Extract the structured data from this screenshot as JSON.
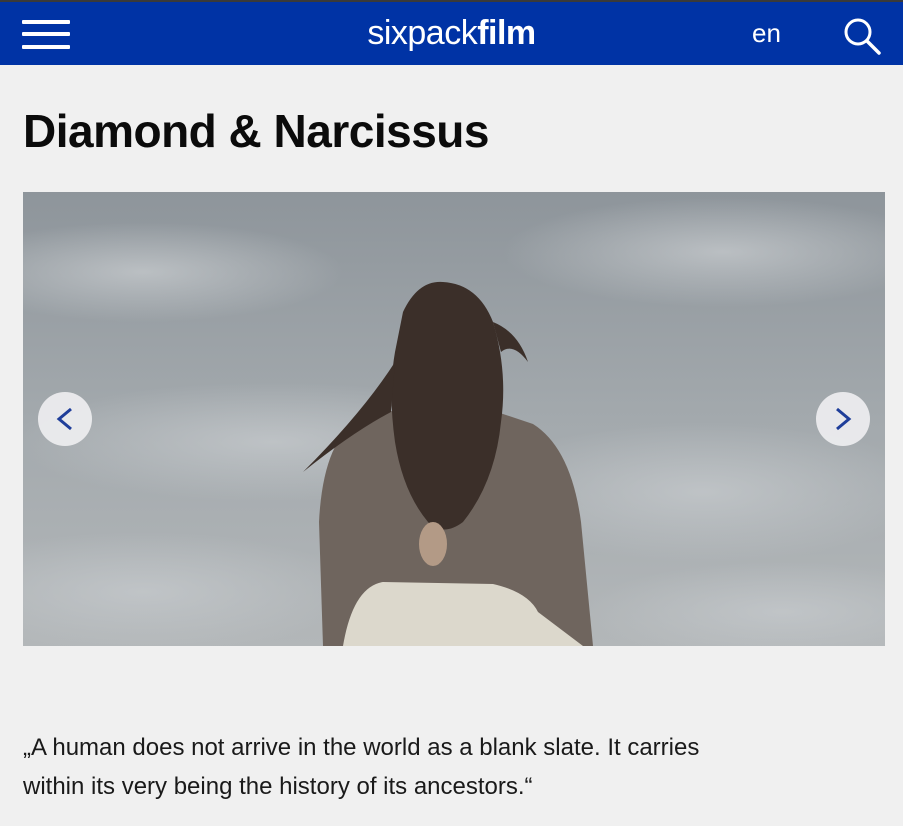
{
  "header": {
    "logo_light": "sixpack",
    "logo_bold": "film",
    "language": "en",
    "bar_color": "#0033a5"
  },
  "page": {
    "title": "Diamond & Narcissus",
    "quote": "„A human does not arrive in the world as a blank slate. It carries within its very being the history of its ancestors.“"
  },
  "icons": {
    "menu": "hamburger-icon",
    "search": "search-icon",
    "prev": "chevron-left-icon",
    "next": "chevron-right-icon"
  }
}
